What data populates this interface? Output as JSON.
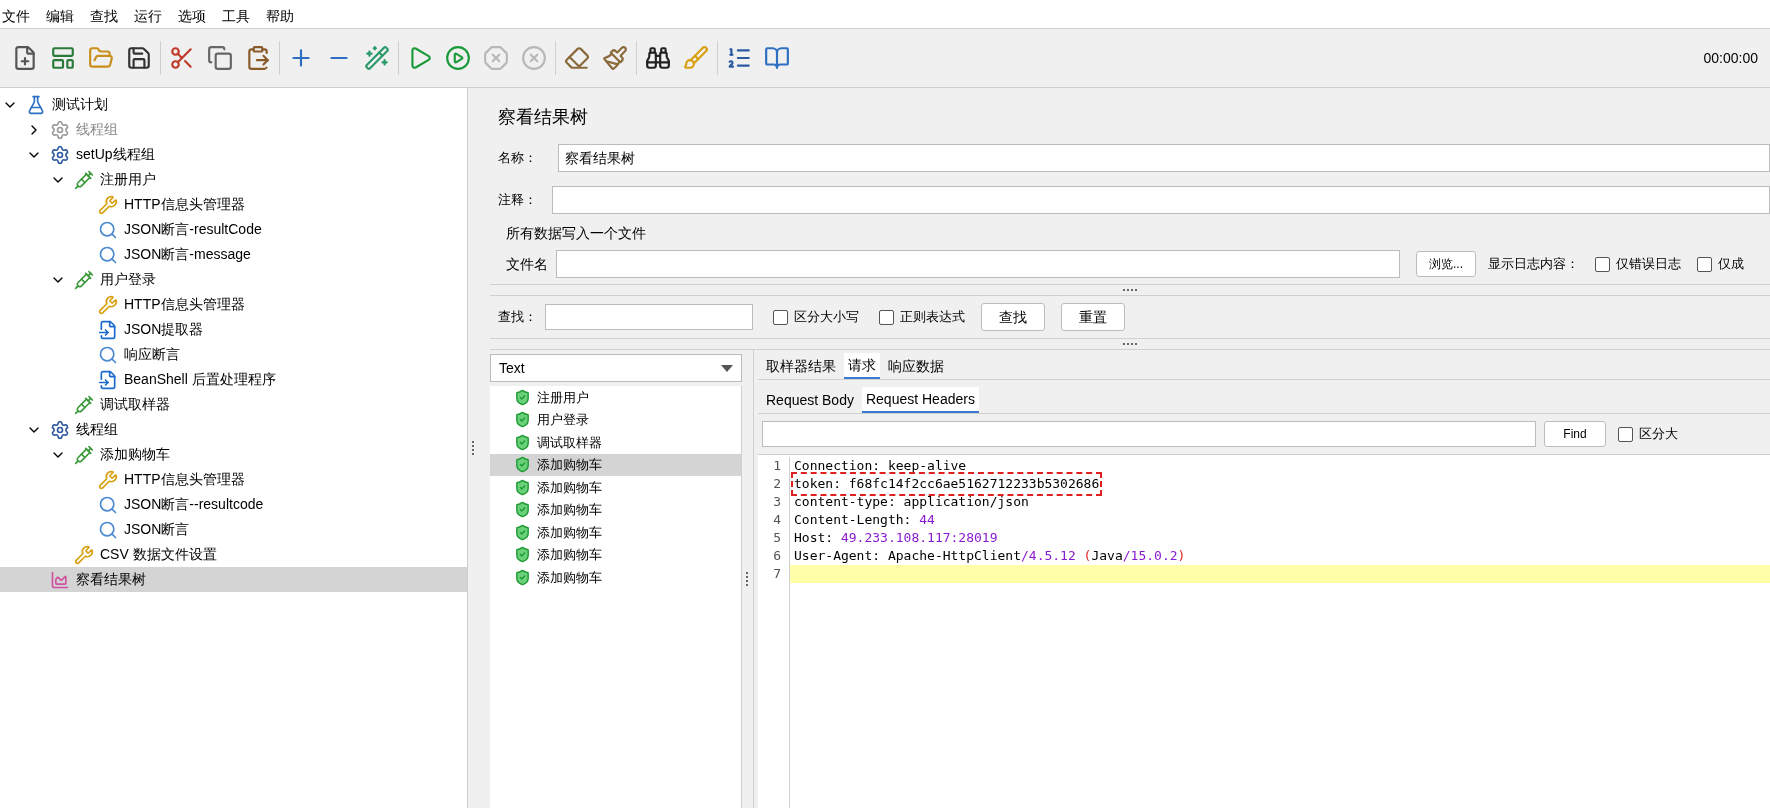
{
  "menu": [
    "文件",
    "编辑",
    "查找",
    "运行",
    "选项",
    "工具",
    "帮助"
  ],
  "toolbar": {
    "groups": [
      [
        {
          "kind": "new",
          "disabled": false
        },
        {
          "kind": "templates",
          "disabled": false
        },
        {
          "kind": "open",
          "disabled": false
        },
        {
          "kind": "save",
          "disabled": false
        }
      ],
      [
        {
          "kind": "cut",
          "disabled": false
        },
        {
          "kind": "copy",
          "disabled": false
        },
        {
          "kind": "paste",
          "disabled": false
        }
      ],
      [
        {
          "kind": "expand",
          "disabled": false
        },
        {
          "kind": "collapse",
          "disabled": false
        },
        {
          "kind": "toggle",
          "disabled": false
        }
      ],
      [
        {
          "kind": "start",
          "disabled": false
        },
        {
          "kind": "start-no-timers",
          "disabled": false
        },
        {
          "kind": "stop",
          "disabled": true
        },
        {
          "kind": "shutdown",
          "disabled": true
        }
      ],
      [
        {
          "kind": "clear",
          "disabled": false
        },
        {
          "kind": "clear-all",
          "disabled": false
        }
      ],
      [
        {
          "kind": "search",
          "disabled": false
        },
        {
          "kind": "reset",
          "disabled": false
        }
      ],
      [
        {
          "kind": "functions",
          "disabled": false
        },
        {
          "kind": "help",
          "disabled": false
        }
      ]
    ],
    "timer": "00:00:00"
  },
  "tree": [
    {
      "label": "测试计划",
      "kind": "plan",
      "disabled": false,
      "selected": false,
      "expanded": true,
      "children": [
        {
          "label": "线程组",
          "kind": "threadgroup",
          "disabled": true,
          "selected": false,
          "expanded": false
        },
        {
          "label": "setUp线程组",
          "kind": "threadgroup",
          "disabled": false,
          "selected": false,
          "expanded": true,
          "children": [
            {
              "label": "注册用户",
              "kind": "sampler",
              "disabled": false,
              "selected": false,
              "expanded": true,
              "children": [
                {
                  "label": "HTTP信息头管理器",
                  "kind": "config",
                  "disabled": false,
                  "selected": false
                },
                {
                  "label": "JSON断言-resultCode",
                  "kind": "assertion",
                  "disabled": false,
                  "selected": false
                },
                {
                  "label": "JSON断言-message",
                  "kind": "assertion",
                  "disabled": false,
                  "selected": false
                }
              ]
            },
            {
              "label": "用户登录",
              "kind": "sampler",
              "disabled": false,
              "selected": false,
              "expanded": true,
              "children": [
                {
                  "label": "HTTP信息头管理器",
                  "kind": "config",
                  "disabled": false,
                  "selected": false
                },
                {
                  "label": "JSON提取器",
                  "kind": "extractor",
                  "disabled": false,
                  "selected": false
                },
                {
                  "label": "响应断言",
                  "kind": "assertion",
                  "disabled": false,
                  "selected": false
                },
                {
                  "label": "BeanShell 后置处理程序",
                  "kind": "extractor",
                  "disabled": false,
                  "selected": false
                }
              ]
            },
            {
              "label": "调试取样器",
              "kind": "sampler",
              "disabled": false,
              "selected": false
            }
          ]
        },
        {
          "label": "线程组",
          "kind": "threadgroup",
          "disabled": false,
          "selected": false,
          "expanded": true,
          "children": [
            {
              "label": "添加购物车",
              "kind": "sampler",
              "disabled": false,
              "selected": false,
              "expanded": true,
              "children": [
                {
                  "label": "HTTP信息头管理器",
                  "kind": "config",
                  "disabled": false,
                  "selected": false
                },
                {
                  "label": "JSON断言--resultcode",
                  "kind": "assertion",
                  "disabled": false,
                  "selected": false
                },
                {
                  "label": "JSON断言",
                  "kind": "assertion",
                  "disabled": false,
                  "selected": false
                }
              ]
            },
            {
              "label": "CSV 数据文件设置",
              "kind": "config",
              "disabled": false,
              "selected": false
            }
          ]
        },
        {
          "label": "察看结果树",
          "kind": "listener",
          "disabled": false,
          "selected": true
        }
      ]
    }
  ],
  "panel": {
    "title": "察看结果树",
    "name": {
      "label": "名称：",
      "value": "察看结果树"
    },
    "comment": {
      "label": "注释："
    },
    "file_group": {
      "title": "所有数据写入一个文件",
      "label": "文件名",
      "browse": "浏览...",
      "log_label": "显示日志内容：",
      "options": [
        {
          "label": "仅错误日志",
          "checked": false
        },
        {
          "label": "仅成",
          "checked": false
        }
      ]
    },
    "search": {
      "label": "查找：",
      "options": [
        {
          "label": "区分大小写",
          "checked": false
        },
        {
          "label": "正则表达式",
          "checked": false
        }
      ],
      "find": "查找",
      "reset": "重置"
    }
  },
  "results": {
    "renderer": "Text",
    "samples": [
      {
        "label": "注册用户",
        "selected": false
      },
      {
        "label": "用户登录",
        "selected": false
      },
      {
        "label": "调试取样器",
        "selected": false
      },
      {
        "label": "添加购物车",
        "selected": true
      },
      {
        "label": "添加购物车",
        "selected": false
      },
      {
        "label": "添加购物车",
        "selected": false
      },
      {
        "label": "添加购物车",
        "selected": false
      },
      {
        "label": "添加购物车",
        "selected": false
      },
      {
        "label": "添加购物车",
        "selected": false
      }
    ]
  },
  "detail": {
    "tabs": [
      {
        "label": "取样器结果",
        "selected": false
      },
      {
        "label": "请求",
        "selected": true
      },
      {
        "label": "响应数据",
        "selected": false
      }
    ],
    "subtabs": [
      {
        "label": "Request Body",
        "selected": false
      },
      {
        "label": "Request Headers",
        "selected": true
      }
    ],
    "find": {
      "button": "Find",
      "option": {
        "label": "区分大",
        "checked": false
      }
    },
    "lines": [
      {
        "number": "1",
        "highlighted": false,
        "segments": [
          {
            "text": "Connection: keep-alive",
            "kind": "key"
          }
        ]
      },
      {
        "number": "2",
        "highlighted": false,
        "boxed": true,
        "segments": [
          {
            "text": "token: f68fc14f2cc6ae5162712233b5302686",
            "kind": "key"
          }
        ]
      },
      {
        "number": "3",
        "highlighted": false,
        "segments": [
          {
            "text": "content-type: application/json",
            "kind": "key"
          }
        ]
      },
      {
        "number": "4",
        "highlighted": false,
        "segments": [
          {
            "text": "Content-Length: ",
            "kind": "key"
          },
          {
            "text": "44",
            "kind": "value"
          }
        ]
      },
      {
        "number": "5",
        "highlighted": false,
        "segments": [
          {
            "text": "Host: ",
            "kind": "key"
          },
          {
            "text": "49.233.108.117:28019",
            "kind": "value"
          }
        ]
      },
      {
        "number": "6",
        "highlighted": false,
        "segments": [
          {
            "text": "User-Agent: Apache-HttpClient",
            "kind": "key"
          },
          {
            "text": "/4.5.12 ",
            "kind": "value"
          },
          {
            "text": "(",
            "kind": "punct"
          },
          {
            "text": "Java",
            "kind": "key"
          },
          {
            "text": "/15.0.2",
            "kind": "value"
          },
          {
            "text": ")",
            "kind": "punct"
          }
        ]
      },
      {
        "number": "7",
        "highlighted": true
      }
    ]
  }
}
